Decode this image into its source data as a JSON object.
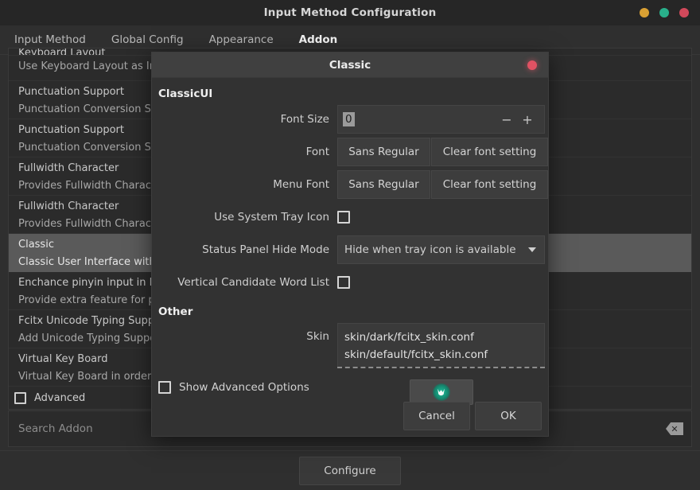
{
  "window": {
    "title": "Input Method Configuration",
    "controls": [
      {
        "name": "minimize",
        "color": "#d9a033"
      },
      {
        "name": "maximize",
        "color": "#29b08b"
      },
      {
        "name": "close",
        "color": "#d1495b"
      }
    ]
  },
  "tabs": [
    {
      "label": "Input Method",
      "active": false
    },
    {
      "label": "Global Config",
      "active": false
    },
    {
      "label": "Appearance",
      "active": false
    },
    {
      "label": "Addon",
      "active": true
    }
  ],
  "addon_list": [
    {
      "name": "Keyboard Layout",
      "desc": "Use Keyboard Layout as In",
      "selected": false,
      "clipped": true
    },
    {
      "name": "Punctuation Support",
      "desc": "Punctuation Conversion Su",
      "selected": false
    },
    {
      "name": "Punctuation Support",
      "desc": "Punctuation Conversion Su",
      "selected": false
    },
    {
      "name": "Fullwidth Character",
      "desc": "Provides Fullwidth Charac",
      "selected": false
    },
    {
      "name": "Fullwidth Character",
      "desc": "Provides Fullwidth Charac",
      "selected": false
    },
    {
      "name": "Classic",
      "desc": "Classic User Interface with",
      "selected": true
    },
    {
      "name": "Enchance pinyin input in F",
      "desc": "Provide extra feature for p",
      "selected": false
    },
    {
      "name": "Fcitx Unicode Typing Supp",
      "desc": "Add Unicode Typing Suppo",
      "selected": false
    },
    {
      "name": "Virtual Key Board",
      "desc": "Virtual Key Board in order",
      "selected": false
    }
  ],
  "main_bottom": {
    "advanced_label": "Advanced",
    "search_placeholder": "Search Addon",
    "clear_icon": "backspace-clear-icon",
    "configure_label": "Configure"
  },
  "dialog": {
    "title": "Classic",
    "close_icon": "close-dot-icon",
    "group_classicui": "ClassicUI",
    "group_other": "Other",
    "font_size": {
      "label": "Font Size",
      "value": "0",
      "decrement": "−",
      "increment": "+"
    },
    "font": {
      "label": "Font",
      "value": "Sans Regular",
      "clear_label": "Clear font setting"
    },
    "menu_font": {
      "label": "Menu Font",
      "value": "Sans Regular",
      "clear_label": "Clear font setting"
    },
    "tray_icon": {
      "label": "Use System Tray Icon",
      "checked": false
    },
    "status_panel": {
      "label": "Status Panel Hide Mode",
      "value": "Hide when tray icon is available"
    },
    "vertical_list": {
      "label": "Vertical Candidate Word List",
      "checked": false
    },
    "skin": {
      "label": "Skin",
      "items": [
        "skin/dark/fcitx_skin.conf",
        "skin/default/fcitx_skin.conf"
      ],
      "config_icon": "fcitx-skin-config-icon"
    },
    "show_advanced": {
      "label": "Show Advanced Options",
      "checked": false
    },
    "cancel_label": "Cancel",
    "ok_label": "OK"
  },
  "colors": {
    "window_bg": "#2f2f2f",
    "panel_bg": "#2b2b2b",
    "dialog_bg": "#323232",
    "selection": "#5a5a5a",
    "accent_teal": "#29b08b",
    "accent_red": "#d1495b",
    "accent_amber": "#d9a033"
  }
}
